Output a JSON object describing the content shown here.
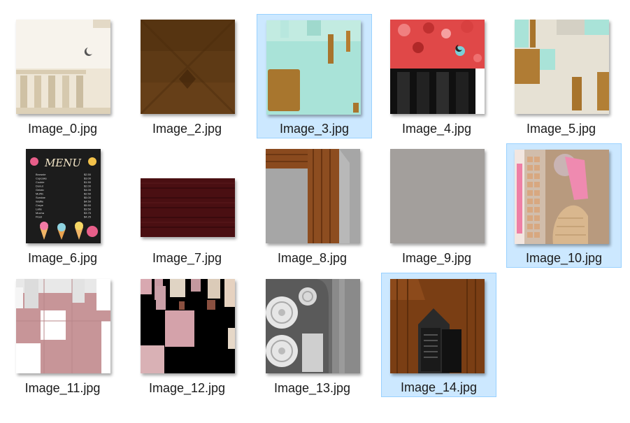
{
  "files": [
    {
      "name": "Image_0.jpg",
      "selected": false
    },
    {
      "name": "Image_2.jpg",
      "selected": false
    },
    {
      "name": "Image_3.jpg",
      "selected": true
    },
    {
      "name": "Image_4.jpg",
      "selected": false
    },
    {
      "name": "Image_5.jpg",
      "selected": false
    },
    {
      "name": "Image_6.jpg",
      "selected": false
    },
    {
      "name": "Image_7.jpg",
      "selected": false
    },
    {
      "name": "Image_8.jpg",
      "selected": false
    },
    {
      "name": "Image_9.jpg",
      "selected": false
    },
    {
      "name": "Image_10.jpg",
      "selected": true
    },
    {
      "name": "Image_11.jpg",
      "selected": false
    },
    {
      "name": "Image_12.jpg",
      "selected": false
    },
    {
      "name": "Image_13.jpg",
      "selected": false
    },
    {
      "name": "Image_14.jpg",
      "selected": true
    }
  ],
  "menu_board": {
    "title": "MENU",
    "items": [
      "Brownie",
      "Cupcake",
      "Cookie",
      "Donut",
      "Gelato",
      "Muffin",
      "Sundae",
      "Waffle",
      "Crepe",
      "Latte",
      "Mocha",
      "Float"
    ],
    "prices": [
      "$2.50",
      "$3.00",
      "$1.50",
      "$2.00",
      "$4.00",
      "$2.50",
      "$5.00",
      "$4.50",
      "$5.50",
      "$3.50",
      "$3.75",
      "$4.25"
    ]
  }
}
